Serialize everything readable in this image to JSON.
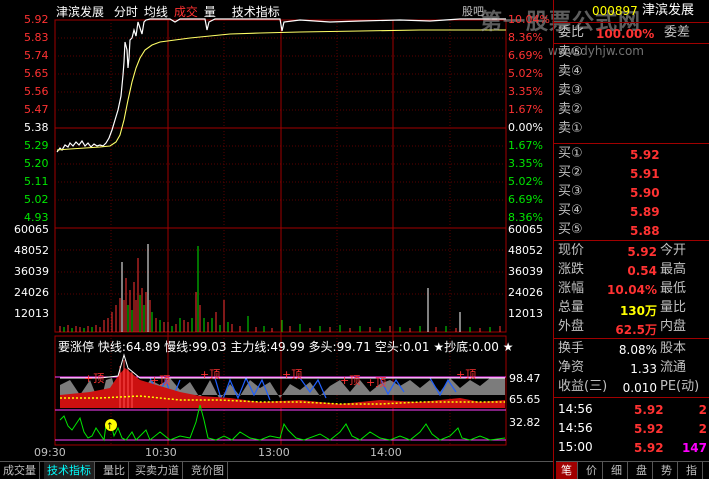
{
  "header": {
    "stock_name": "津滨发展",
    "time_tab": "分时",
    "avg_tab": "均线",
    "vol_tab_a": "成交",
    "vol_tab_b": "量",
    "tech_tab": "技术指标",
    "guba": "股吧",
    "stock_code": "000897",
    "stock_name_right": "津滨发展",
    "watermark": "第一股票公式网",
    "watermark_url": "www.dyhjw.com"
  },
  "price_axis": {
    "left": [
      "5.92",
      "5.83",
      "5.74",
      "5.65",
      "5.56",
      "5.47",
      "5.38",
      "5.29",
      "5.20",
      "5.11",
      "5.02",
      "4.93"
    ],
    "left_colors": [
      "red",
      "red",
      "red",
      "red",
      "red",
      "red",
      "white",
      "green",
      "green",
      "green",
      "green",
      "green"
    ],
    "right": [
      "10.04%",
      "8.36%",
      "6.69%",
      "5.02%",
      "3.35%",
      "1.67%",
      "0.00%",
      "1.67%",
      "3.35%",
      "5.02%",
      "6.69%",
      "8.36%"
    ],
    "right_colors": [
      "red",
      "red",
      "red",
      "red",
      "red",
      "red",
      "white",
      "green",
      "green",
      "green",
      "green",
      "green"
    ]
  },
  "volume_axis": {
    "left": [
      "60065",
      "48052",
      "36039",
      "24026",
      "12013"
    ],
    "right": [
      "60065",
      "48052",
      "36039",
      "24026",
      "12013"
    ]
  },
  "indicator": {
    "title": "要涨停",
    "fast_label": "快线:64.89",
    "slow_label": "慢线:99.03",
    "main_label": "主力线:49.99",
    "long_label": "多头:99.71",
    "short_label": "空头:0.01",
    "bottom_label": "★抄底:0.00",
    "star": "★",
    "axis": [
      "98.47",
      "65.65",
      "32.82"
    ],
    "top_marks": [
      "顶",
      "顶",
      "顶",
      "顶",
      "顶",
      "顶",
      "顶",
      "顶"
    ]
  },
  "time_axis": [
    "09:30",
    "10:30",
    "13:00",
    "14:00"
  ],
  "bottom_tabs": [
    "成交量",
    "技术指标",
    "量比",
    "买卖力道",
    "竞价图"
  ],
  "right_tabs": [
    "笔",
    "价",
    "细",
    "盘",
    "势",
    "指"
  ],
  "order_book": {
    "ratio_label": "委比",
    "ratio_value": "100.00%",
    "diff_label": "委差",
    "sells": [
      "卖⑤",
      "卖④",
      "卖③",
      "卖②",
      "卖①"
    ],
    "buys": [
      {
        "label": "买①",
        "price": "5.92"
      },
      {
        "label": "买②",
        "price": "5.91"
      },
      {
        "label": "买③",
        "price": "5.90"
      },
      {
        "label": "买④",
        "price": "5.89"
      },
      {
        "label": "买⑤",
        "price": "5.88"
      }
    ]
  },
  "quote": [
    {
      "label": "现价",
      "value": "5.92",
      "label2": "今开"
    },
    {
      "label": "涨跌",
      "value": "0.54",
      "label2": "最高"
    },
    {
      "label": "涨幅",
      "value": "10.04%",
      "label2": "最低"
    },
    {
      "label": "总量",
      "value": "130万",
      "label2": "量比"
    },
    {
      "label": "外盘",
      "value": "62.5万",
      "label2": "内盘"
    }
  ],
  "quote2": [
    {
      "label": "换手",
      "value": "8.08%",
      "label2": "股本"
    },
    {
      "label": "净资",
      "value": "1.33",
      "label2": "流通"
    },
    {
      "label": "收益(三)",
      "value": "0.010",
      "label2": "PE(动)"
    }
  ],
  "ticks": [
    {
      "time": "14:56",
      "price": "5.92",
      "vol": "2"
    },
    {
      "time": "14:56",
      "price": "5.92",
      "vol": "2"
    },
    {
      "time": "15:00",
      "price": "5.92",
      "vol": "147"
    }
  ]
}
